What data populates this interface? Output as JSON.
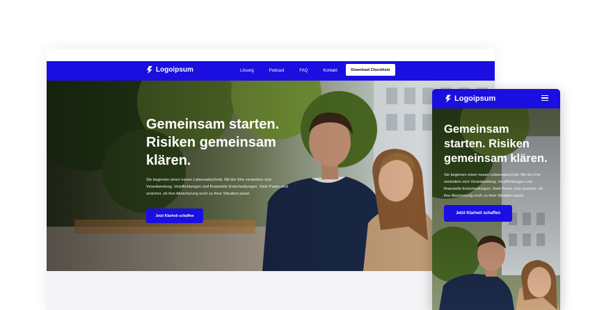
{
  "brand": {
    "name": "Logoipsum",
    "accent_color": "#1a0fe0"
  },
  "desktop": {
    "nav": {
      "links": [
        "Lösung",
        "Podcast",
        "FAQ",
        "Kontakt"
      ],
      "cta_label": "Download Checkliste"
    },
    "hero": {
      "headline": "Gemeinsam starten. Risiken gemeinsam klären.",
      "body": "Sie beginnen einen neuen Lebensabschnitt. Mit der Ehe verändern sich Verantwortung, Verpflichtungen und finanzielle Entscheidungen. Viele Paare sind unsicher, ob ihre Absicherung noch zu ihrer Situation passt.",
      "button_label": "Jetzt Klarheit schaffen"
    }
  },
  "mobile": {
    "nav": {
      "menu_icon": "hamburger-menu-icon"
    },
    "hero": {
      "headline": "Gemeinsam starten. Risiken gemeinsam klären.",
      "body": "Sie beginnen einen neuen Lebensabschnitt. Mit der Ehe verändern sich Verantwortung, Verpflichtungen und finanzielle Entscheidungen. Viele Paare sind unsicher, ob ihre Absicherung noch zu ihrer Situation passt.",
      "button_label": "Jetzt Klarheit schaffen"
    }
  }
}
